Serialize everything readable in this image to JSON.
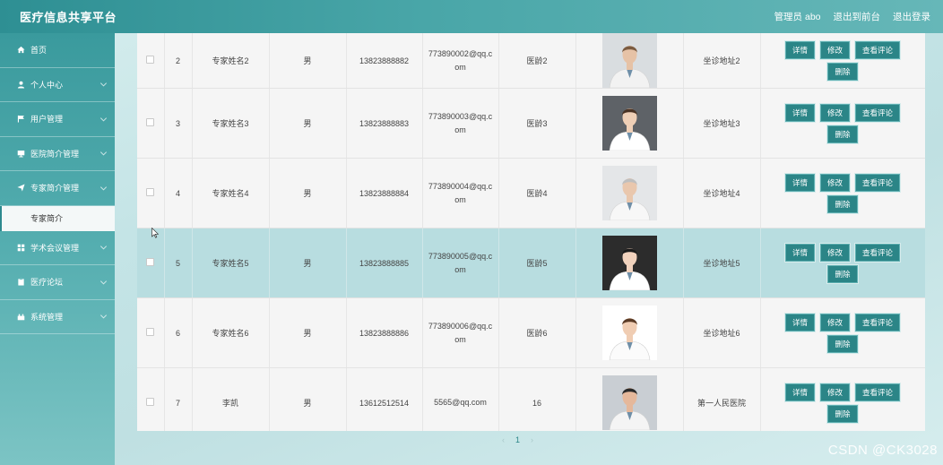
{
  "header": {
    "title": "医疗信息共享平台",
    "user_label": "管理员 abo",
    "exit_front_label": "退出到前台",
    "logout_label": "退出登录"
  },
  "sidebar": {
    "items": [
      {
        "label": "首页",
        "icon": "home-icon"
      },
      {
        "label": "个人中心",
        "icon": "user-icon"
      },
      {
        "label": "用户管理",
        "icon": "flag-icon"
      },
      {
        "label": "医院简介管理",
        "icon": "monitor-icon"
      },
      {
        "label": "专家简介管理",
        "icon": "send-icon"
      },
      {
        "label": "学术会议管理",
        "icon": "grid-icon"
      },
      {
        "label": "医疗论坛",
        "icon": "clipboard-icon"
      },
      {
        "label": "系统管理",
        "icon": "settings-icon"
      }
    ],
    "active_submenu": "专家简介"
  },
  "table": {
    "rows": [
      {
        "id": "2",
        "name": "专家姓名2",
        "gender": "男",
        "phone": "13823888882",
        "email": "773890002@qq.com",
        "dept": "医龄2",
        "address": "坐诊地址2"
      },
      {
        "id": "3",
        "name": "专家姓名3",
        "gender": "男",
        "phone": "13823888883",
        "email": "773890003@qq.com",
        "dept": "医龄3",
        "address": "坐诊地址3"
      },
      {
        "id": "4",
        "name": "专家姓名4",
        "gender": "男",
        "phone": "13823888884",
        "email": "773890004@qq.com",
        "dept": "医龄4",
        "address": "坐诊地址4"
      },
      {
        "id": "5",
        "name": "专家姓名5",
        "gender": "男",
        "phone": "13823888885",
        "email": "773890005@qq.com",
        "dept": "医龄5",
        "address": "坐诊地址5"
      },
      {
        "id": "6",
        "name": "专家姓名6",
        "gender": "男",
        "phone": "13823888886",
        "email": "773890006@qq.com",
        "dept": "医龄6",
        "address": "坐诊地址6"
      },
      {
        "id": "7",
        "name": "李凯",
        "gender": "男",
        "phone": "13612512514",
        "email": "5565@qq.com",
        "dept": "16",
        "address": "第一人民医院"
      }
    ],
    "actions": {
      "detail": "详情",
      "edit": "修改",
      "comments": "查看评论",
      "delete": "删除"
    }
  },
  "pagination": {
    "prev": "‹",
    "current": "1",
    "next": "›"
  },
  "watermark": "CSDN @CK3028",
  "colors": {
    "accent": "#2b8587",
    "header": "#3a9a9d",
    "highlight_row": "#b8dde0"
  }
}
